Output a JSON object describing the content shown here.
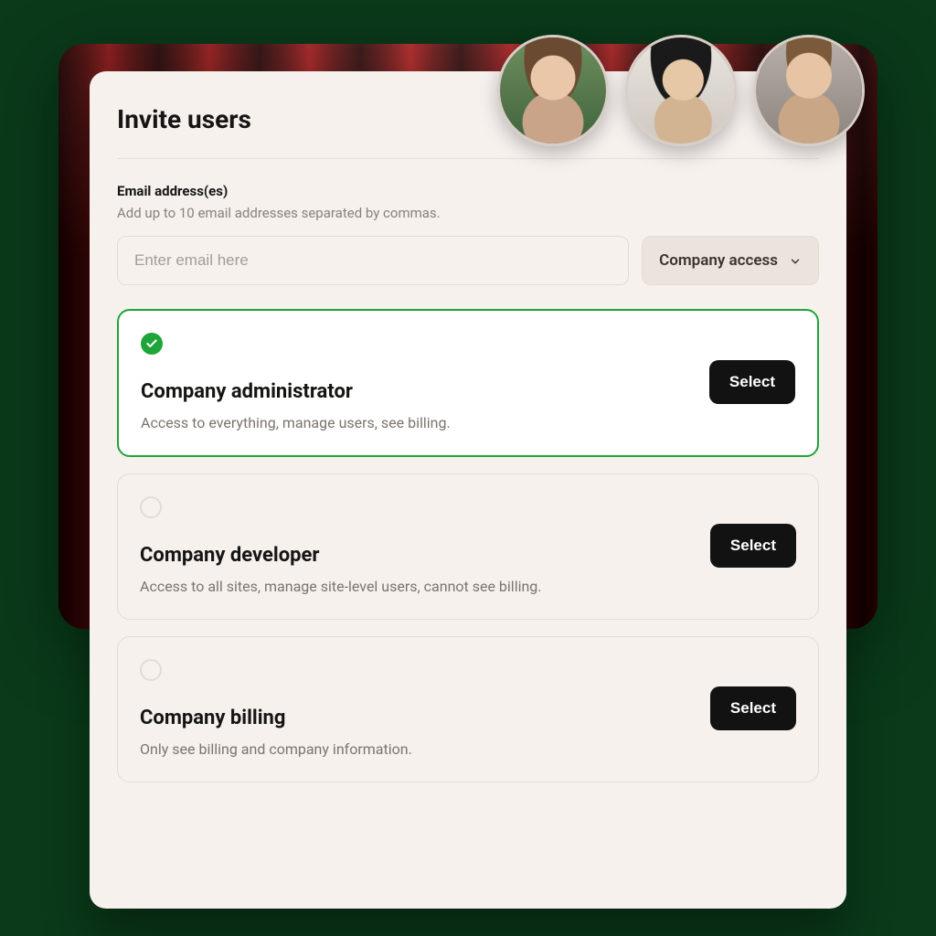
{
  "header": {
    "title": "Invite users"
  },
  "email": {
    "label": "Email address(es)",
    "hint": "Add up to 10 email addresses separated by commas.",
    "placeholder": "Enter email here"
  },
  "access_dropdown": {
    "label": "Company access"
  },
  "select_label": "Select",
  "roles": [
    {
      "title": "Company administrator",
      "desc": "Access to everything, manage users, see billing.",
      "selected": true
    },
    {
      "title": "Company developer",
      "desc": "Access to all sites, manage site-level users, cannot see billing.",
      "selected": false
    },
    {
      "title": "Company billing",
      "desc": "Only see billing and company information.",
      "selected": false
    }
  ],
  "avatars": [
    "user-1",
    "user-2",
    "user-3"
  ],
  "colors": {
    "accent_green": "#1ea53a",
    "button_black": "#121212"
  }
}
